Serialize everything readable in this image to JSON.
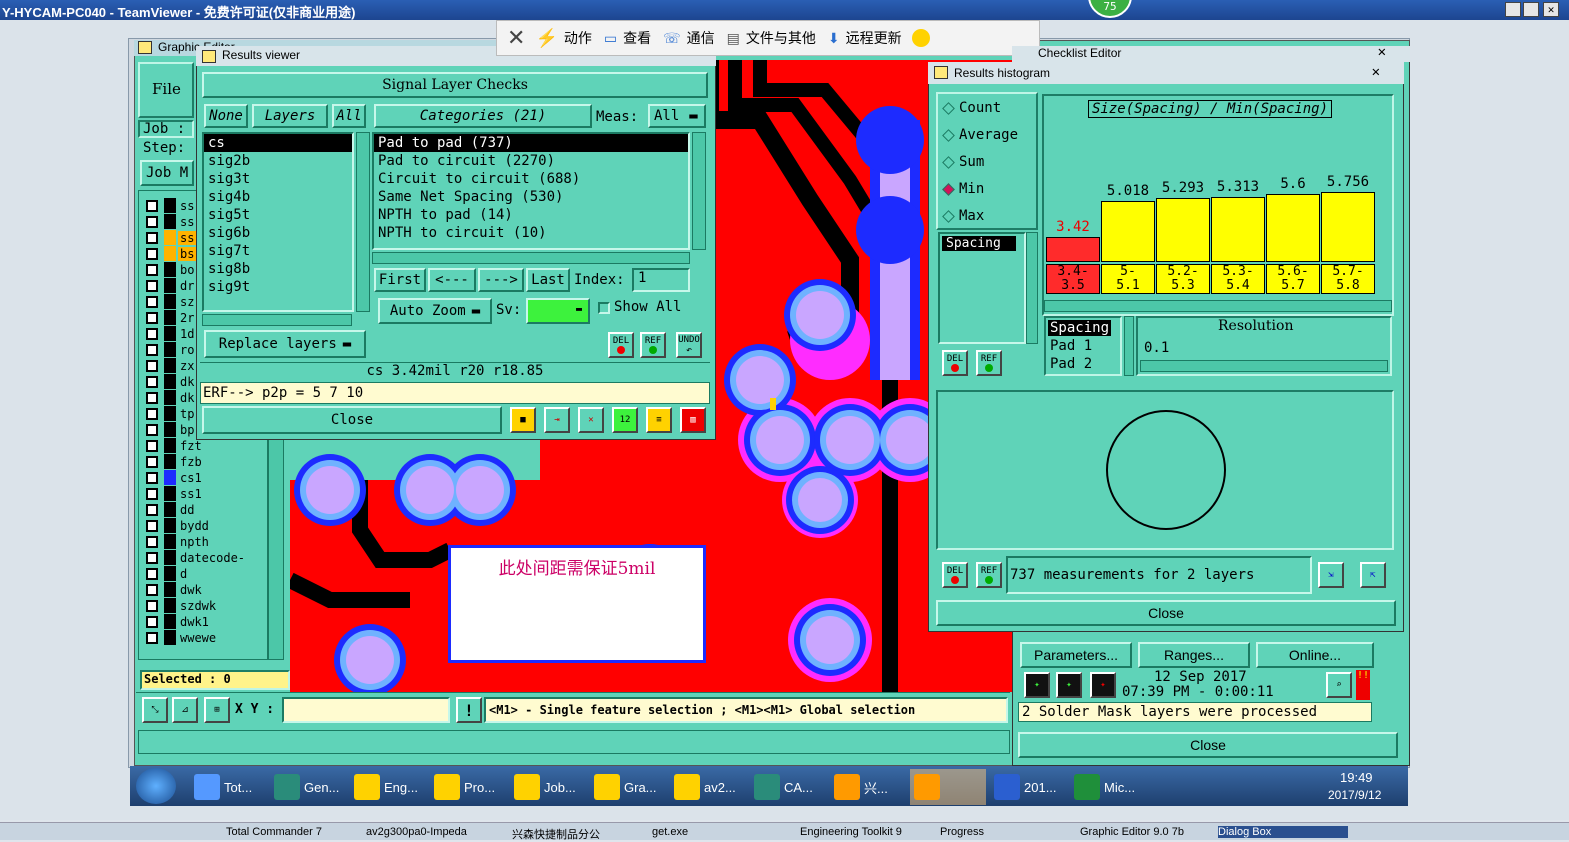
{
  "teamviewer": {
    "title": "Y-HYCAM-PC040 - TeamViewer - 免费许可证(仅非商业用途)",
    "badge": "75",
    "toolbar": {
      "actions": "动作",
      "view": "查看",
      "comm": "通信",
      "files": "文件与其他",
      "update": "远程更新"
    }
  },
  "graphic_editor": {
    "title": "Graphic Editor",
    "file_menu": "File",
    "job_label": "Job :",
    "step_label": "Step:",
    "job_matrix": "Job M",
    "layers": [
      "ss",
      "ss",
      "ss",
      "bs",
      "bo",
      "dr",
      "sz",
      "2r",
      "1d",
      "ro",
      "zx",
      "dk",
      "dk",
      "tp",
      "bp",
      "fzt",
      "fzb",
      "cs1",
      "ss1",
      "dd",
      "bydd",
      "npth",
      "datecode-ptc",
      "d",
      "dwk",
      "szdwk",
      "dwk1",
      "wwewe"
    ],
    "selected": "Selected : 0",
    "xy_label": "X Y :",
    "status_msg": "<M1> - Single feature selection ; <M1><M1> Global selection",
    "annotation": "此处间距需保证5mil"
  },
  "results_viewer": {
    "title": "Results viewer",
    "header": "Signal Layer Checks",
    "none_btn": "None",
    "layers_btn": "Layers",
    "all_btn": "All",
    "categories_btn": "Categories (21)",
    "meas_label": "Meas:",
    "meas_value": "All",
    "layer_list": [
      "cs",
      "sig2b",
      "sig3t",
      "sig4b",
      "sig5t",
      "sig6b",
      "sig7t",
      "sig8b",
      "sig9t"
    ],
    "category_list": [
      "Pad to pad (737)",
      "Pad to circuit (2270)",
      "Circuit to circuit (688)",
      "Same Net Spacing (530)",
      "NPTH to pad (14)",
      "NPTH to circuit (10)"
    ],
    "first": "First",
    "prev": "<---",
    "next": "--->",
    "last": "Last",
    "index_label": "Index:",
    "index_value": "1",
    "auto_zoom": "Auto Zoom",
    "sv_label": "Sv:",
    "show_all": "Show All",
    "replace_layers": "Replace layers",
    "info_line": "cs 3.42mil  r20  r18.85",
    "erf_line": "ERF--> p2p = 5 7 10",
    "close": "Close",
    "del": "DEL",
    "ref": "REF",
    "undo": "UNDO"
  },
  "histogram": {
    "title": "Results histogram",
    "modes": [
      "Count",
      "Average",
      "Sum",
      "Min",
      "Max"
    ],
    "selected_mode": "Min",
    "chart_title": "Size(Spacing) / Min(Spacing)",
    "bars": [
      {
        "value": "3.42",
        "range_lo": "3.4-",
        "range_hi": "3.5",
        "color": "#ff2b2b"
      },
      {
        "value": "5.018",
        "range_lo": "5-",
        "range_hi": "5.1",
        "color": "#ffff00"
      },
      {
        "value": "5.293",
        "range_lo": "5.2-",
        "range_hi": "5.3",
        "color": "#ffff00"
      },
      {
        "value": "5.313",
        "range_lo": "5.3-",
        "range_hi": "5.4",
        "color": "#ffff00"
      },
      {
        "value": "5.6",
        "range_lo": "5.6-",
        "range_hi": "5.7",
        "color": "#ffff00"
      },
      {
        "value": "5.756",
        "range_lo": "5.7-",
        "range_hi": "5.8",
        "color": "#ffff00"
      }
    ],
    "spacing_item": "Spacing",
    "pad_list": [
      "Spacing",
      "Pad 1",
      "Pad 2"
    ],
    "resolution_label": "Resolution",
    "resolution_value": "0.1",
    "measurements": "737 measurements for 2 layers",
    "close": "Close"
  },
  "checklist": {
    "title": "Checklist Editor",
    "parameters": "Parameters...",
    "ranges": "Ranges...",
    "online": "Online...",
    "date": "12 Sep 2017",
    "time": "07:39 PM - 0:00:11",
    "status": "2 Solder Mask layers were processed",
    "close": "Close"
  },
  "taskbar": {
    "items": [
      "Tot...",
      "Gen...",
      "Eng...",
      "Pro...",
      "Job...",
      "Gra...",
      "av2...",
      "CA...",
      "兴...",
      "",
      "201...",
      "Mic..."
    ],
    "clock_time": "19:49",
    "clock_date": "2017/9/12"
  },
  "bottom_strip": [
    "Total Commander 7",
    "av2g300pa0-Impeda",
    "兴森快捷制品分公",
    "get.exe",
    "Engineering Toolkit 9",
    "Progress",
    "Graphic Editor 9.0 7b",
    "Dialog Box"
  ]
}
